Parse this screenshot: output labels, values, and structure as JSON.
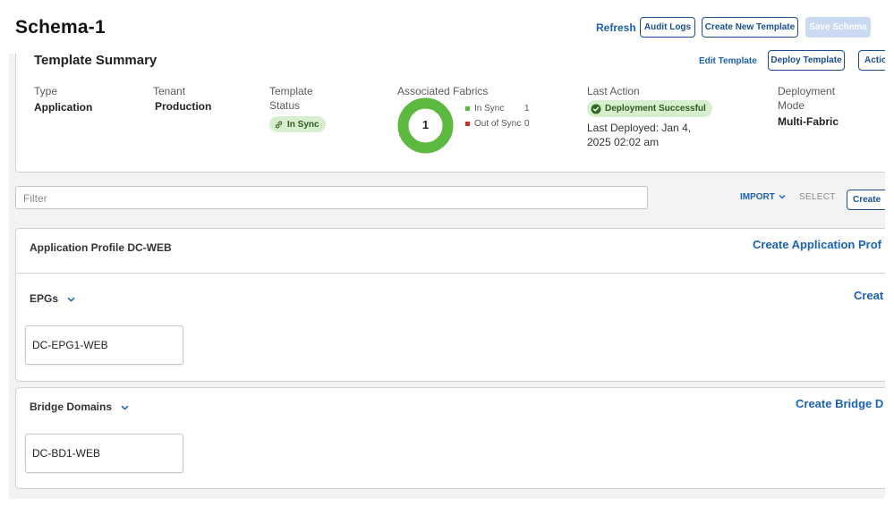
{
  "header": {
    "title": "Schema-1",
    "refresh_label": "Refresh",
    "audit_logs_label": "Audit Logs",
    "create_template_label": "Create New Template",
    "save_schema_label": "Save Schema"
  },
  "summary": {
    "title": "Template Summary",
    "edit_template_label": "Edit Template",
    "deploy_template_label": "Deploy Template",
    "actions_label": "Actio",
    "type_label": "Type",
    "type_value": "Application",
    "tenant_label": "Tenant",
    "tenant_value": "Production",
    "status_label": "Template Status",
    "status_value": "In Sync",
    "fabrics_label": "Associated Fabrics",
    "fabrics_total": "1",
    "in_sync_label": "In Sync",
    "in_sync_count": "1",
    "out_of_sync_label": "Out of Sync",
    "out_of_sync_count": "0",
    "last_action_label": "Last Action",
    "last_action_value": "Deployment Successful",
    "last_deployed": "Last Deployed: Jan 4, 2025 02:02 am",
    "deployment_mode_label": "Deployment Mode",
    "deployment_mode_value": "Multi-Fabric",
    "colors": {
      "in_sync": "#5cb93f",
      "out_of_sync": "#d0312d",
      "accent": "#1b62b3"
    }
  },
  "filter": {
    "placeholder": "Filter",
    "import_label": "IMPORT",
    "select_label": "SELECT",
    "create_label": "Create"
  },
  "app_profile": {
    "title": "Application Profile DC-WEB",
    "create_label": "Create Application Prof"
  },
  "epgs": {
    "title": "EPGs",
    "create_label": "Creat",
    "items": [
      "DC-EPG1-WEB"
    ]
  },
  "bridge_domains": {
    "title": "Bridge Domains",
    "create_label": "Create Bridge D",
    "items": [
      "DC-BD1-WEB"
    ]
  }
}
